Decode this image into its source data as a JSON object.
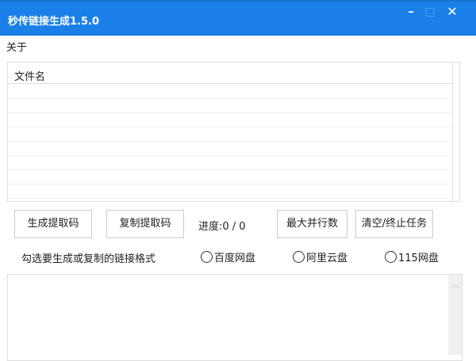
{
  "window": {
    "title": "秒传链接生成1.5.0",
    "minimize": "–",
    "maximize": "□",
    "close": "✕"
  },
  "menu": {
    "about": "关于"
  },
  "table": {
    "columns": [
      "文件名"
    ],
    "rows": []
  },
  "buttons": {
    "generate": "生成提取码",
    "copy": "复制提取码",
    "max_parallel": "最大并行数",
    "clear_stop": "清空/终止任务"
  },
  "progress": {
    "label": "进度:0 / 0",
    "done": 0,
    "total": 0
  },
  "format": {
    "hint": "勾选要生成或复制的链接格式",
    "options": [
      {
        "label": "百度网盘",
        "checked": false
      },
      {
        "label": "阿里云盘",
        "checked": false
      },
      {
        "label": "115网盘",
        "checked": false
      }
    ]
  },
  "output": {
    "value": ""
  }
}
